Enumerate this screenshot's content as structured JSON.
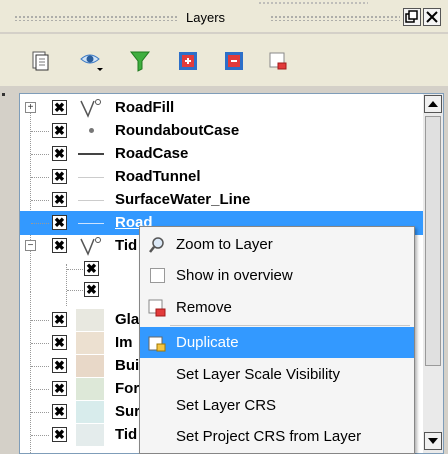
{
  "panel": {
    "title": "Layers",
    "float_icon": "float-icon",
    "close_icon": "close-icon"
  },
  "toolbar": {
    "tools": [
      "add-group-icon",
      "visibility-eye-icon",
      "filter-icon",
      "expand-all-icon",
      "collapse-all-icon",
      "remove-icon"
    ]
  },
  "layers": [
    {
      "name": "RoadFill",
      "checked": "✖",
      "symbol": "line-v-icon",
      "expander": "+"
    },
    {
      "name": "RoundaboutCase",
      "checked": "✖",
      "symbol": "point-icon"
    },
    {
      "name": "RoadCase",
      "checked": "✖",
      "symbol": "line-icon"
    },
    {
      "name": "RoadTunnel",
      "checked": "✖",
      "symbol": "line-thin-icon"
    },
    {
      "name": "SurfaceWater_Line",
      "checked": "✖",
      "symbol": "line-thin-icon"
    },
    {
      "name": "Road",
      "checked": "✖",
      "symbol": "line-thin-icon",
      "selected": true
    },
    {
      "name": "Tid",
      "checked": "✖",
      "symbol": "line-v-icon",
      "expander": "−"
    },
    {
      "name": "",
      "checked": "✖",
      "symbol": "line-thin-icon"
    },
    {
      "name": "",
      "checked": "✖",
      "symbol": "line-thin-icon"
    },
    {
      "name": "Gla",
      "checked": "✖",
      "symbol": "fill-icon",
      "color": "#e8e8e0"
    },
    {
      "name": "Im",
      "checked": "✖",
      "symbol": "fill-icon",
      "color": "#ece0d0"
    },
    {
      "name": "Bui",
      "checked": "✖",
      "symbol": "fill-icon",
      "color": "#e8d8c8"
    },
    {
      "name": "For",
      "checked": "✖",
      "symbol": "fill-icon",
      "color": "#dde8d8"
    },
    {
      "name": "Sur",
      "checked": "✖",
      "symbol": "fill-icon",
      "color": "#d8ecec"
    },
    {
      "name": "Tid",
      "checked": "✖",
      "symbol": "fill-icon",
      "color": "#e4ecec"
    }
  ],
  "context_menu": {
    "items": [
      {
        "label": "Zoom to Layer",
        "icon": "zoom-icon"
      },
      {
        "label": "Show in overview",
        "icon": "checkbox-icon"
      },
      {
        "label": "Remove",
        "icon": "remove-layer-icon"
      },
      {
        "label": "Duplicate",
        "icon": "duplicate-icon",
        "highlighted": true
      },
      {
        "label": "Set Layer Scale Visibility",
        "icon": ""
      },
      {
        "label": "Set Layer CRS",
        "icon": ""
      },
      {
        "label": "Set Project CRS from Layer",
        "icon": ""
      }
    ]
  },
  "colors": {
    "selection": "#3399ff",
    "window_bg": "#ece9d8"
  }
}
